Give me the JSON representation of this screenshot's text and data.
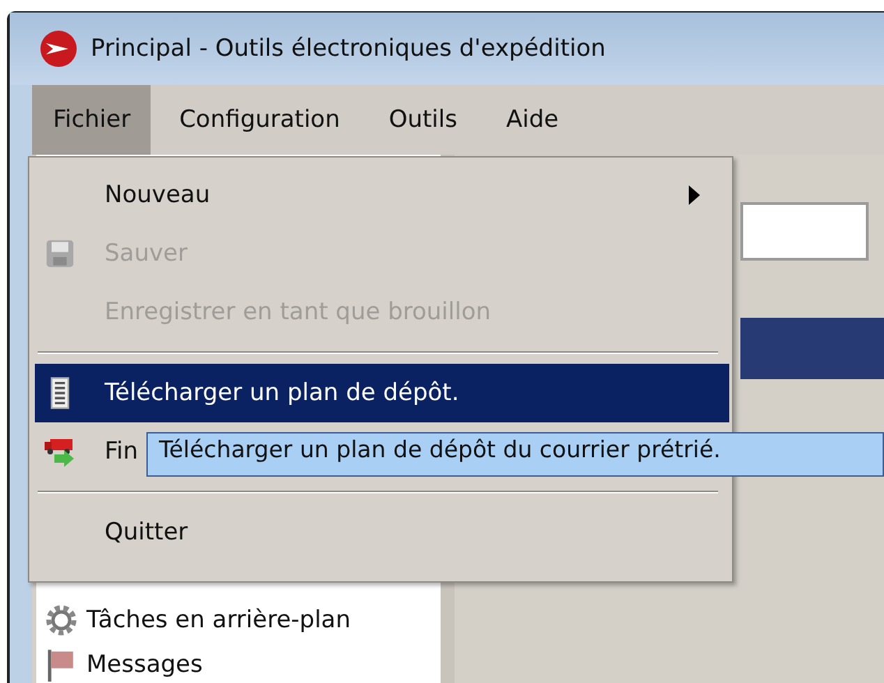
{
  "window": {
    "title": "Principal - Outils électroniques d'expédition"
  },
  "menu_bar": [
    {
      "label": "Fichier",
      "selected": true
    },
    {
      "label": "Configuration",
      "selected": false
    },
    {
      "label": "Outils",
      "selected": false
    },
    {
      "label": "Aide",
      "selected": false
    }
  ],
  "file_menu": {
    "items": [
      {
        "kind": "item",
        "label": "Nouveau",
        "disabled": false,
        "selected": false,
        "submenu": true
      },
      {
        "kind": "item",
        "label": "Sauver",
        "disabled": true,
        "selected": false,
        "submenu": false
      },
      {
        "kind": "item",
        "label": "Enregistrer en tant que brouillon",
        "disabled": true,
        "selected": false,
        "submenu": false
      },
      {
        "kind": "separator"
      },
      {
        "kind": "item",
        "label": "Télécharger un plan de dépôt.",
        "disabled": false,
        "selected": true,
        "submenu": false
      },
      {
        "kind": "item",
        "label": "Fin",
        "disabled": false,
        "selected": false
      },
      {
        "kind": "separator"
      },
      {
        "kind": "item",
        "label": "Quitter",
        "disabled": false,
        "selected": false,
        "submenu": false
      }
    ]
  },
  "tooltip": {
    "text": "Télécharger un plan de dépôt du courrier prétrié."
  },
  "sidebar": {
    "items": [
      {
        "label": "Tâches en arrière-plan"
      },
      {
        "label": "Messages"
      }
    ]
  }
}
